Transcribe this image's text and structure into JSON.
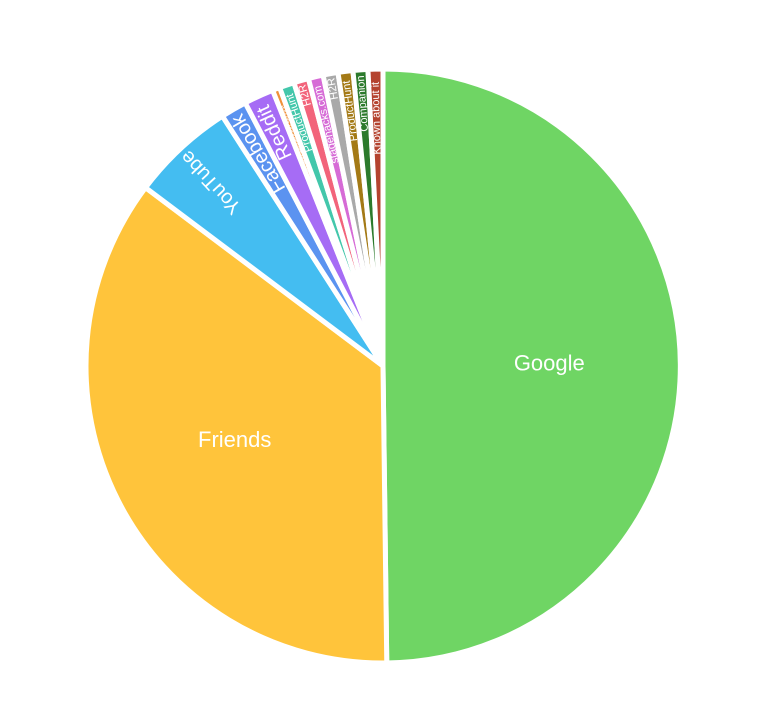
{
  "chart_data": {
    "type": "pie",
    "legend": "none",
    "slices": [
      {
        "label": "Google",
        "value": 49.3,
        "color": "#6fd564"
      },
      {
        "label": "Friends",
        "value": 35.1,
        "color": "#ffc43b"
      },
      {
        "label": "YouTube",
        "value": 5.6,
        "color": "#44bdf1"
      },
      {
        "label": "Facebook",
        "value": 1.4,
        "color": "#5b93f0"
      },
      {
        "label": "Reddit",
        "value": 1.6,
        "color": "#a66cf5"
      },
      {
        "label": "Already used a smart and sequencing service",
        "value": 0.4,
        "color": "#f0913a"
      },
      {
        "label": "ProductHunt",
        "value": 0.8,
        "color": "#43c7ab"
      },
      {
        "label": "H2R",
        "value": 0.8,
        "color": "#f2647b"
      },
      {
        "label": "stagehacks.com",
        "value": 0.8,
        "color": "#d66bd6"
      },
      {
        "label": "H2R",
        "value": 0.8,
        "color": "#a9a9a9"
      },
      {
        "label": "ProductHunt",
        "value": 0.8,
        "color": "#a47a16"
      },
      {
        "label": "Companion",
        "value": 0.8,
        "color": "#2c7a2c"
      },
      {
        "label": "Known about it",
        "value": 0.8,
        "color": "#b4432f"
      }
    ]
  }
}
